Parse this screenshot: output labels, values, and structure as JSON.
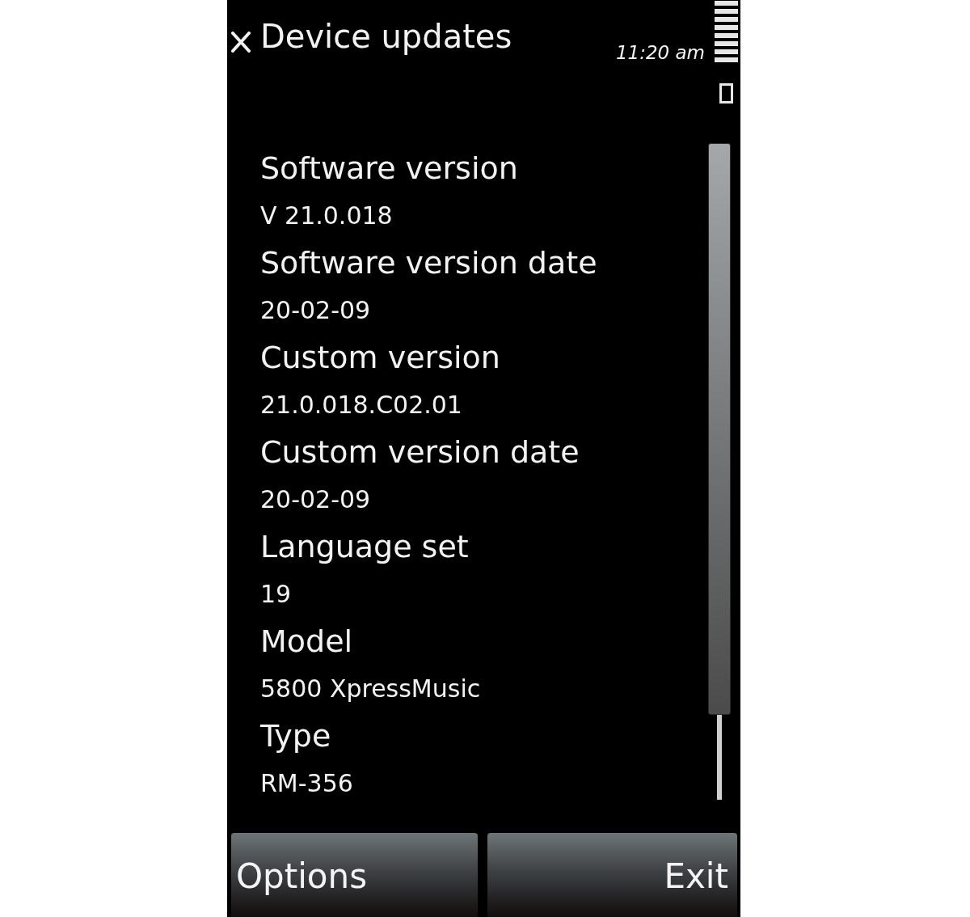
{
  "window": {
    "title": "Device updates"
  },
  "status_bar": {
    "time": "11:20 am"
  },
  "details": [
    {
      "label": "Software version",
      "value": "V 21.0.018"
    },
    {
      "label": "Software version date",
      "value": "20-02-09"
    },
    {
      "label": "Custom version",
      "value": "21.0.018.C02.01"
    },
    {
      "label": "Custom version date",
      "value": "20-02-09"
    },
    {
      "label": "Language set",
      "value": "19"
    },
    {
      "label": "Model",
      "value": "5800 XpressMusic"
    },
    {
      "label": "Type",
      "value": "RM-356"
    }
  ],
  "softkeys": [
    {
      "label": "Options"
    },
    {
      "label": "Exit"
    }
  ]
}
